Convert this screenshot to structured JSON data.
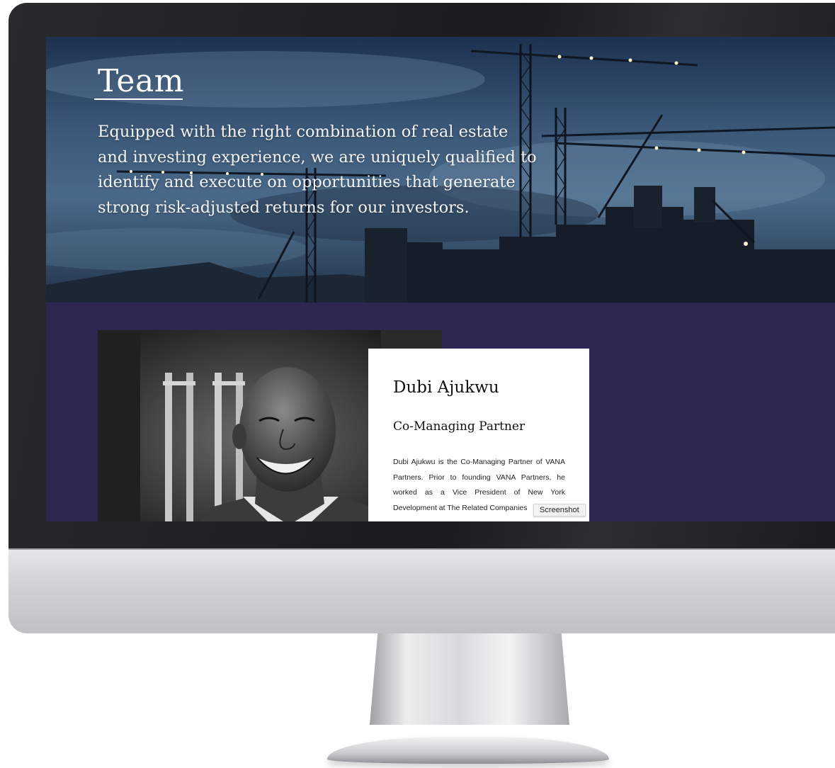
{
  "hero": {
    "title": "Team",
    "description": "Equipped with the right combination of real estate and investing experience, we are uniquely qualified to identify and execute on opportunities that generate strong risk-adjusted returns for our investors."
  },
  "member": {
    "name": "Dubi Ajukwu",
    "role": "Co-Managing Partner",
    "bio": "Dubi Ajukwu is the Co-Managing Partner of VANA Partners. Prior to founding VANA Partners, he worked as a Vice President of New York Development at The Related Companies"
  },
  "tooltip": {
    "label": "Screenshot"
  },
  "colors": {
    "section_background": "#2c2750",
    "card_background": "#ffffff",
    "hero_sky": "#2e4a68"
  },
  "icons": {
    "photo": "portrait-photo",
    "hero": "construction-cranes-image"
  }
}
